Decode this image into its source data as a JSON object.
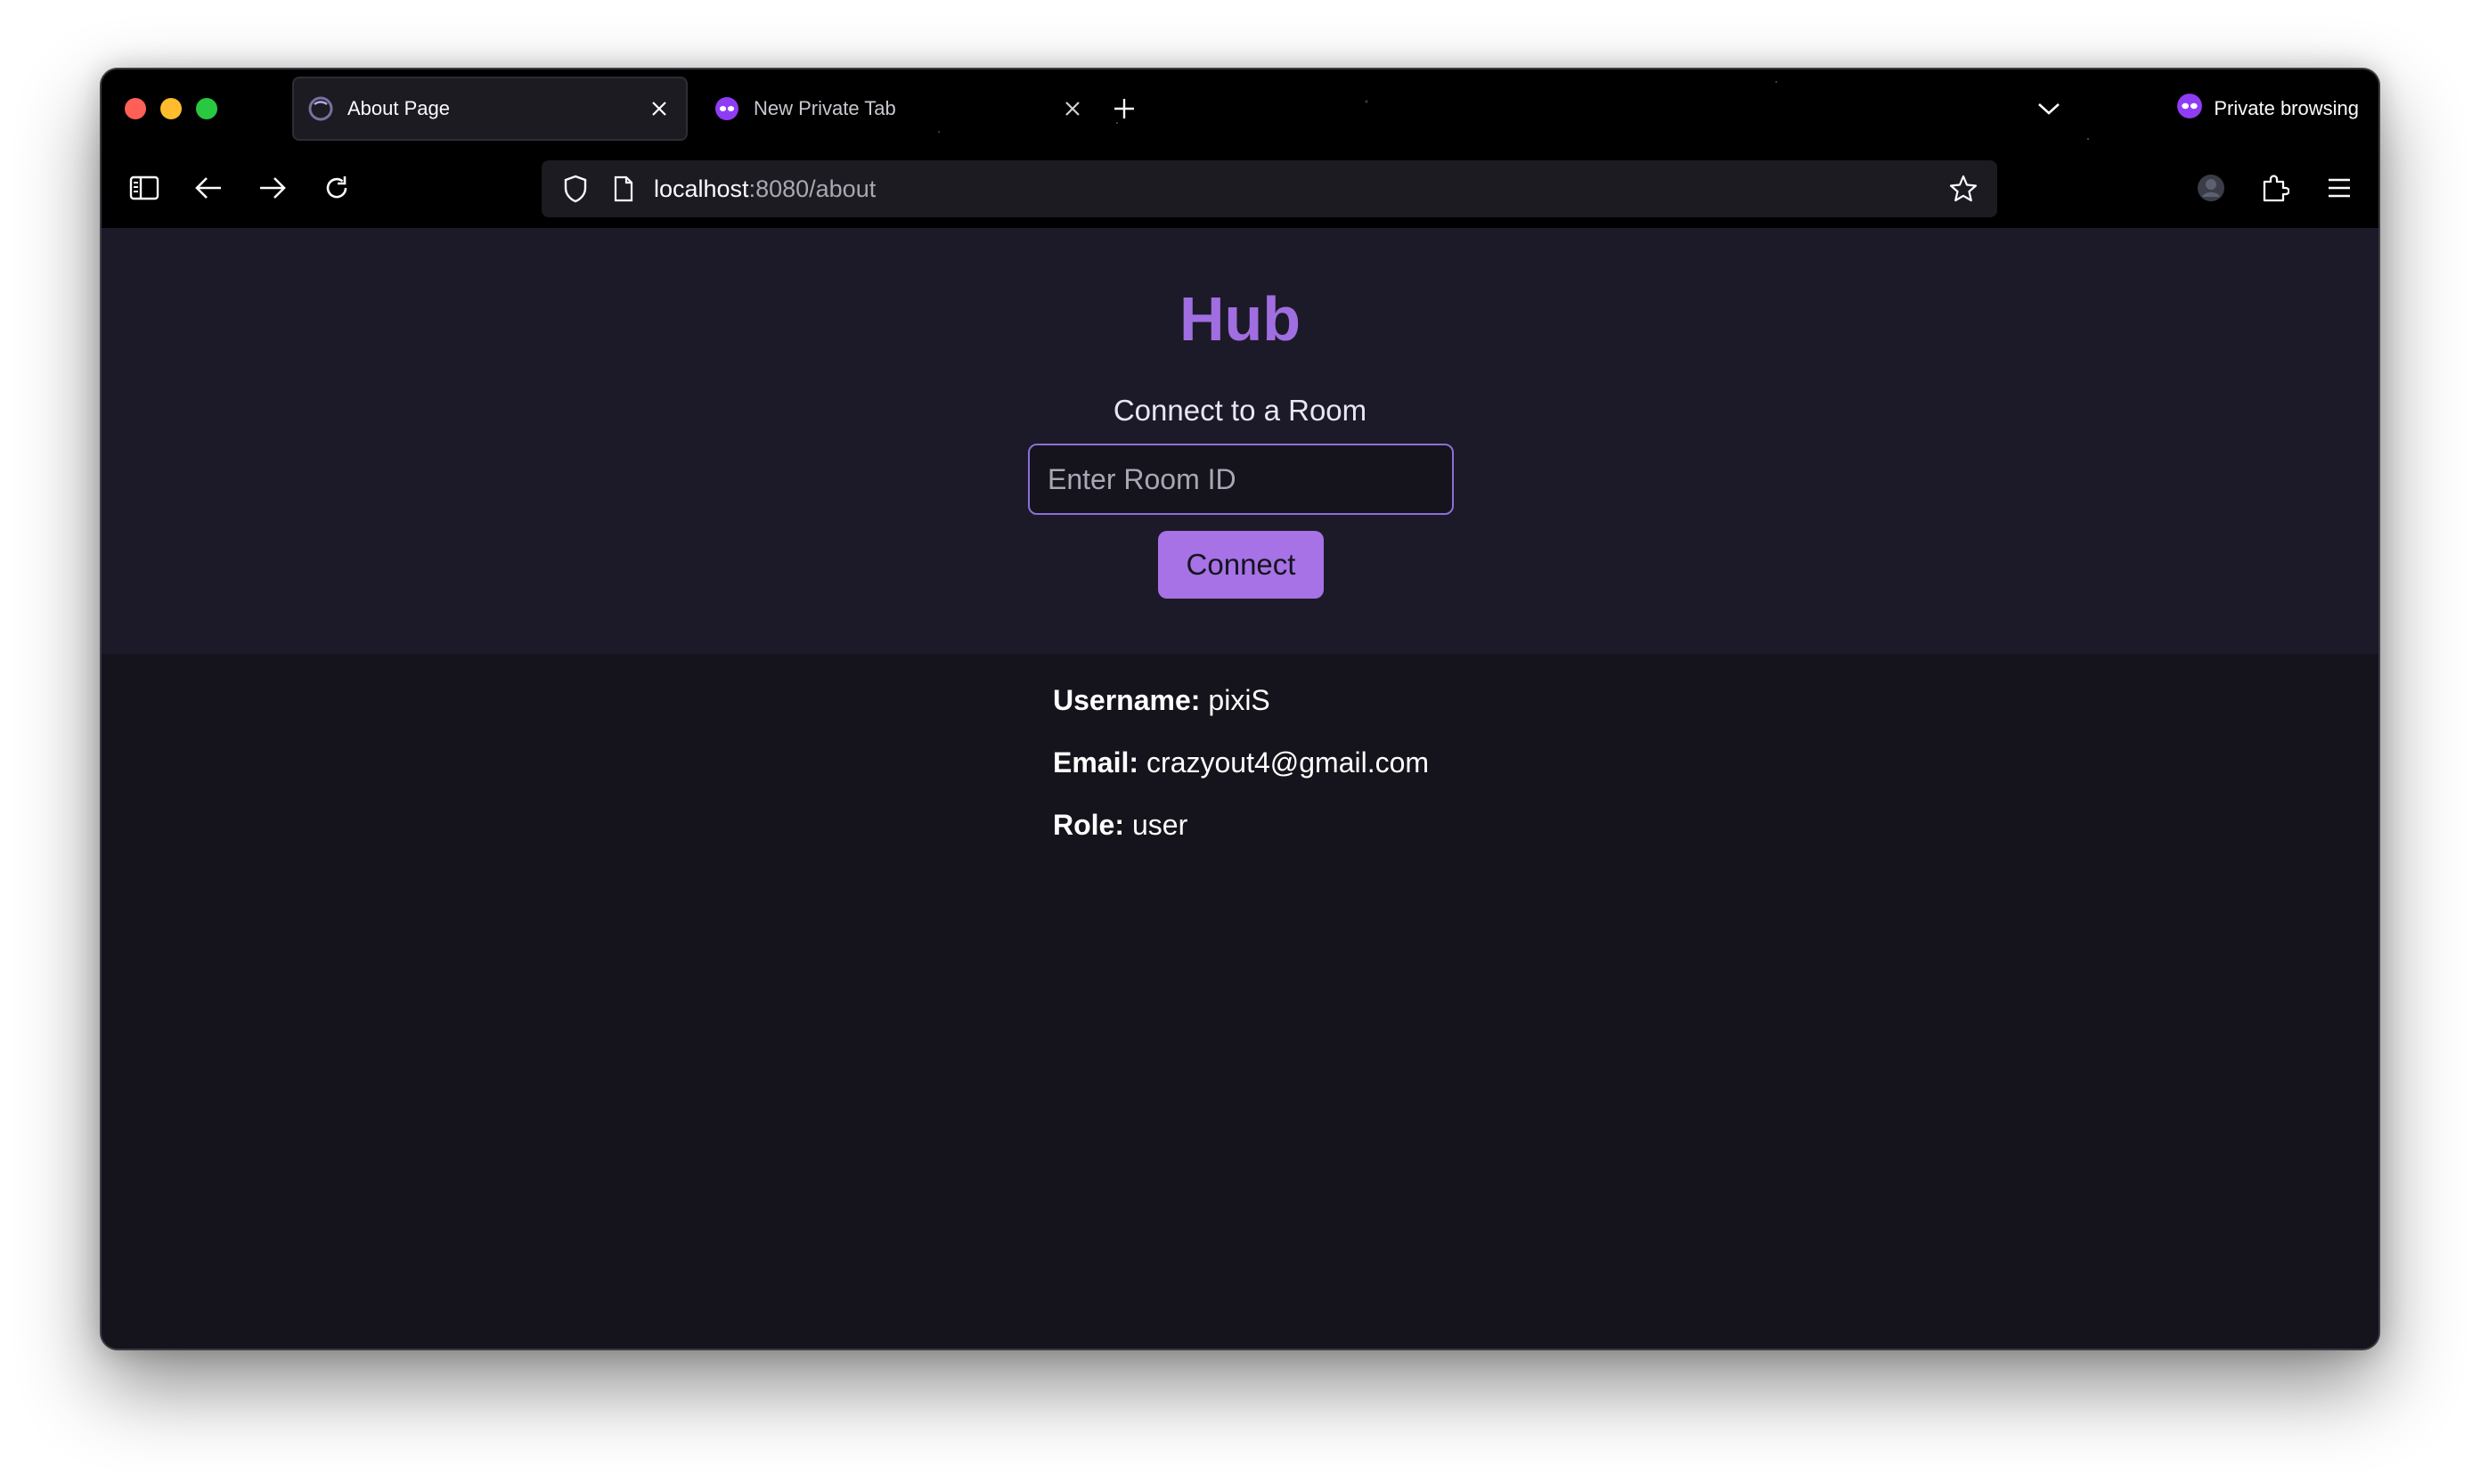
{
  "tabs": [
    {
      "title": "About Page",
      "active": true,
      "favicon": "app-logo-icon"
    },
    {
      "title": "New Private Tab",
      "active": false,
      "favicon": "private-mask-icon"
    }
  ],
  "private_indicator": {
    "label": "Private browsing",
    "icon": "private-mask-icon"
  },
  "url": {
    "host": "localhost",
    "path": ":8080/about"
  },
  "page": {
    "title": "Hub",
    "subtitle": "Connect to a Room",
    "room_input": {
      "placeholder": "Enter Room ID",
      "value": ""
    },
    "connect_label": "Connect",
    "user_info": {
      "username_label": "Username:",
      "username": "pixiS",
      "email_label": "Email:",
      "email": "crazyout4@gmail.com",
      "role_label": "Role:",
      "role": "user"
    }
  },
  "colors": {
    "accent": "#a672e6",
    "title": "#a06ee0",
    "hero_bg": "#1c1a28",
    "page_bg": "#15141c",
    "chrome_bg": "#000000"
  }
}
